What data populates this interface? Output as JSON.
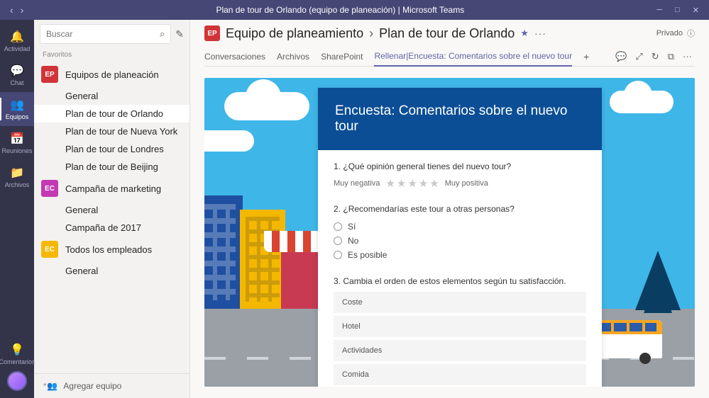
{
  "titlebar": {
    "title": "Plan de tour de Orlando (equipo de planeación) | Microsoft Teams"
  },
  "rail": {
    "items": [
      {
        "icon": "🔔",
        "label": "Actividad"
      },
      {
        "icon": "💬",
        "label": "Chat"
      },
      {
        "icon": "👥",
        "label": "Equipos"
      },
      {
        "icon": "📅",
        "label": "Reuniones"
      },
      {
        "icon": "📁",
        "label": "Archivos"
      }
    ],
    "feedback": {
      "icon": "💡",
      "label": "Comentarios"
    }
  },
  "sidebar": {
    "search_placeholder": "Buscar",
    "favorites_label": "Favoritos",
    "teams": [
      {
        "avatar": "EP",
        "color": "#d13438",
        "name": "Equipos de planeación",
        "channels": [
          "General",
          "Plan de tour de Orlando",
          "Plan de tour de Nueva York",
          "Plan de tour de Londres",
          "Plan de tour de Beijing"
        ],
        "selected_channel": 1
      },
      {
        "avatar": "EC",
        "color": "#c239b3",
        "name": "Campaña de marketing",
        "channels": [
          "General",
          "Campaña de 2017"
        ]
      },
      {
        "avatar": "EC",
        "color": "#f5b800",
        "name": "Todos los empleados",
        "channels": [
          "General"
        ]
      }
    ],
    "add_team": "Agregar equipo"
  },
  "header": {
    "team": "Equipo de planeamiento",
    "channel": "Plan de tour de Orlando",
    "privacy": "Privado",
    "tabs": [
      "Conversaciones",
      "Archivos",
      "SharePoint"
    ],
    "active_tab_prefix": "Rellenar",
    "active_tab_name": "Encuesta: Comentarios sobre el nuevo tour"
  },
  "form": {
    "title": "Encuesta: Comentarios sobre el nuevo tour",
    "q1": {
      "num": "1.",
      "text": "¿Qué opinión general tienes del nuevo tour?",
      "low": "Muy negativa",
      "high": "Muy positiva"
    },
    "q2": {
      "num": "2.",
      "text": "¿Recomendarías este tour a otras personas?",
      "options": [
        "Sí",
        "No",
        "Es posible"
      ]
    },
    "q3": {
      "num": "3.",
      "text": "Cambia el orden de estos elementos según tu satisfacción.",
      "items": [
        "Coste",
        "Hotel",
        "Actividades",
        "Comida"
      ]
    }
  }
}
